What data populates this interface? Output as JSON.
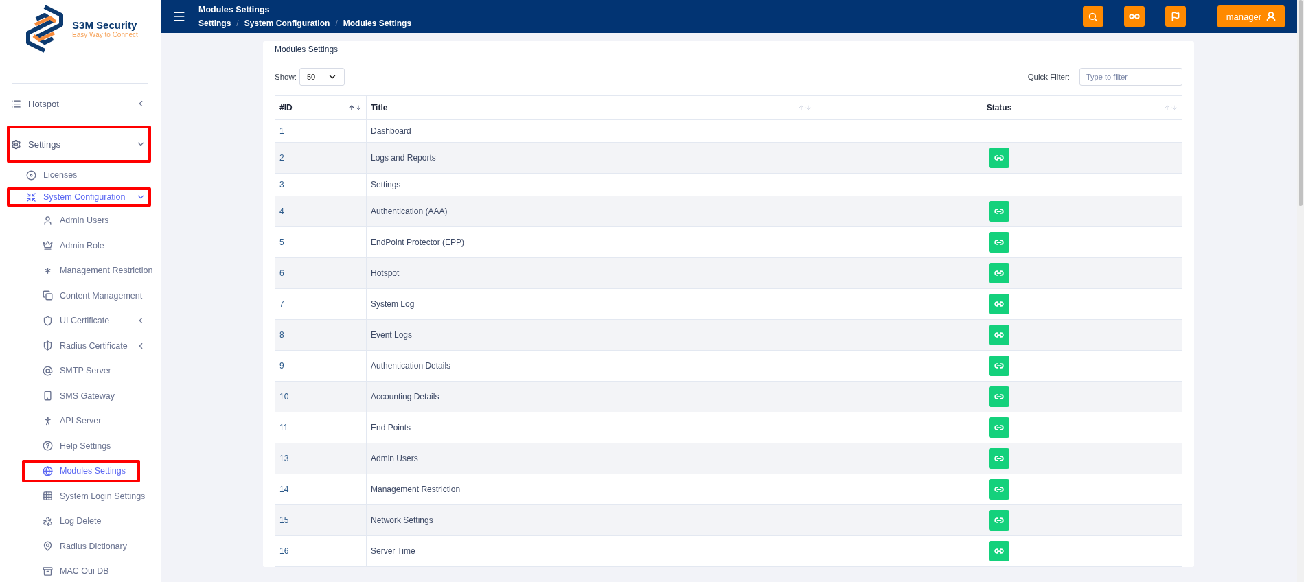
{
  "brand": {
    "name": "S3M Security",
    "tagline": "Easy Way to Connect"
  },
  "sidebar": {
    "items": [
      {
        "label": "Hotspot",
        "kind": "group",
        "expanded": false,
        "active": false,
        "highlighted": false
      },
      {
        "label": "Settings",
        "kind": "group",
        "expanded": true,
        "active": false,
        "highlighted": true,
        "children": [
          {
            "label": "Licenses",
            "kind": "item",
            "active": false,
            "highlighted": false
          },
          {
            "label": "System Configuration",
            "kind": "group",
            "expanded": true,
            "active": true,
            "highlighted": true,
            "children": [
              {
                "label": "Admin Users",
                "kind": "item",
                "active": false,
                "highlighted": false
              },
              {
                "label": "Admin Role",
                "kind": "item",
                "active": false,
                "highlighted": false
              },
              {
                "label": "Management Restriction",
                "kind": "item",
                "active": false,
                "highlighted": false
              },
              {
                "label": "Content Management",
                "kind": "item",
                "active": false,
                "highlighted": false
              },
              {
                "label": "UI Certificate",
                "kind": "group",
                "expanded": false,
                "active": false,
                "highlighted": false
              },
              {
                "label": "Radius Certificate",
                "kind": "group",
                "expanded": false,
                "active": false,
                "highlighted": false
              },
              {
                "label": "SMTP Server",
                "kind": "item",
                "active": false,
                "highlighted": false
              },
              {
                "label": "SMS Gateway",
                "kind": "item",
                "active": false,
                "highlighted": false
              },
              {
                "label": "API Server",
                "kind": "item",
                "active": false,
                "highlighted": false
              },
              {
                "label": "Help Settings",
                "kind": "item",
                "active": false,
                "highlighted": false
              },
              {
                "label": "Modules Settings",
                "kind": "item",
                "active": true,
                "highlighted": true
              },
              {
                "label": "System Login Settings",
                "kind": "item",
                "active": false,
                "highlighted": false
              },
              {
                "label": "Log Delete",
                "kind": "item",
                "active": false,
                "highlighted": false
              },
              {
                "label": "Radius Dictionary",
                "kind": "item",
                "active": false,
                "highlighted": false
              },
              {
                "label": "MAC Oui DB",
                "kind": "item",
                "active": false,
                "highlighted": false
              }
            ]
          }
        ]
      }
    ]
  },
  "header": {
    "title": "Modules Settings",
    "separator": "/",
    "breadcrumb": [
      "Settings",
      "System Configuration",
      "Modules Settings"
    ],
    "user": "manager"
  },
  "card": {
    "title": "Modules Settings",
    "show_label": "Show:",
    "page_size": "50",
    "filter_label": "Quick Filter:",
    "filter_placeholder": "Type to filter"
  },
  "table": {
    "columns": [
      {
        "label": "#ID",
        "sorted": true
      },
      {
        "label": "Title",
        "sorted": false
      },
      {
        "label": "Status",
        "sorted": false
      }
    ],
    "rows": [
      {
        "id": "1",
        "title": "Dashboard",
        "has_link": false
      },
      {
        "id": "2",
        "title": "Logs and Reports",
        "has_link": true
      },
      {
        "id": "3",
        "title": "Settings",
        "has_link": false
      },
      {
        "id": "4",
        "title": "Authentication (AAA)",
        "has_link": true
      },
      {
        "id": "5",
        "title": "EndPoint Protector (EPP)",
        "has_link": true
      },
      {
        "id": "6",
        "title": "Hotspot",
        "has_link": true
      },
      {
        "id": "7",
        "title": "System Log",
        "has_link": true
      },
      {
        "id": "8",
        "title": "Event Logs",
        "has_link": true
      },
      {
        "id": "9",
        "title": "Authentication Details",
        "has_link": true
      },
      {
        "id": "10",
        "title": "Accounting Details",
        "has_link": true
      },
      {
        "id": "11",
        "title": "End Points",
        "has_link": true
      },
      {
        "id": "13",
        "title": "Admin Users",
        "has_link": true
      },
      {
        "id": "14",
        "title": "Management Restriction",
        "has_link": true
      },
      {
        "id": "15",
        "title": "Network Settings",
        "has_link": true
      },
      {
        "id": "16",
        "title": "Server Time",
        "has_link": true
      }
    ]
  }
}
